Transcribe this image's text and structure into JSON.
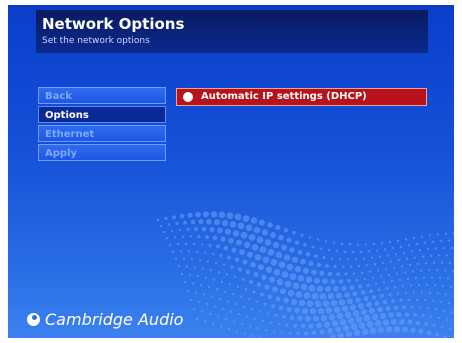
{
  "header": {
    "title": "Network Options",
    "subtitle": "Set the network options"
  },
  "menu": {
    "items": [
      {
        "label": "Back",
        "active": false
      },
      {
        "label": "Options",
        "active": true
      },
      {
        "label": "Ethernet",
        "active": false
      },
      {
        "label": "Apply",
        "active": false
      }
    ]
  },
  "settings": {
    "dhcp_label": "Automatic IP settings (DHCP)",
    "dhcp_icon": "radio-filled-icon",
    "dhcp_color": "#b8121b"
  },
  "brand": {
    "logo_text": "Cambridge Audio"
  },
  "colors": {
    "background": "#1552d8",
    "header": "#0a1a60",
    "accent": "#b8121b",
    "menu_active": "#0a2a9a"
  }
}
